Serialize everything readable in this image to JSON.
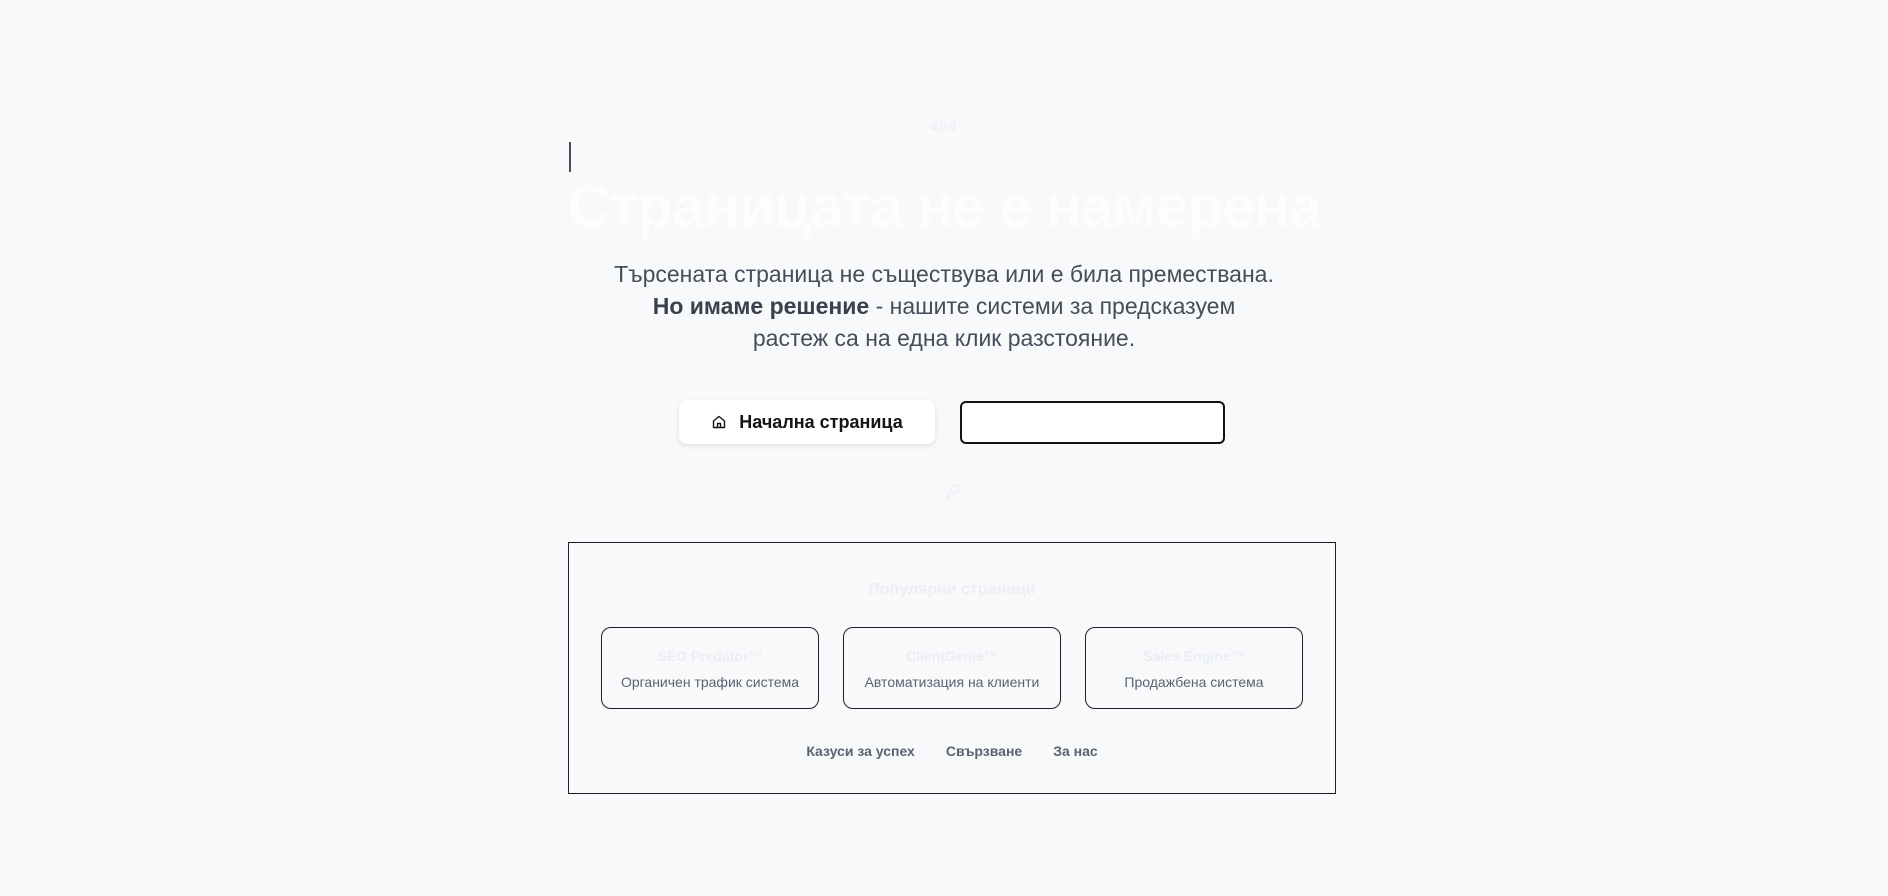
{
  "error": {
    "code": "404",
    "title": "Страницата не е намерена"
  },
  "message": {
    "line1": "Търсената страница не съществува или е била премествана.",
    "bold": "Но имаме решение",
    "rest_a": " - нашите системи за предсказуем",
    "line3": "растеж са на една клик разстояние."
  },
  "actions": {
    "home_label": "Начална страница",
    "home_icon": "home-icon",
    "secondary_label": ""
  },
  "popular": {
    "title": "Популярни страници",
    "cards": [
      {
        "name": "SEO Predator™",
        "desc": "Органичен трафик система"
      },
      {
        "name": "ClientGenie™",
        "desc": "Автоматизация на клиенти"
      },
      {
        "name": "Sales Engine™",
        "desc": "Продажбена система"
      }
    ],
    "links": [
      "Казуси за успех",
      "Свързване",
      "За нас"
    ]
  },
  "colors": {
    "background": "#f8f9fb",
    "text": "#3b4250",
    "border": "#1d2026"
  }
}
